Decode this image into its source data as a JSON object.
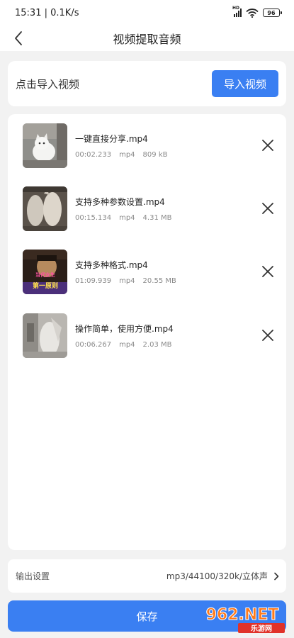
{
  "status_bar": {
    "time": "15:31 | 0.1K/s",
    "network_badge": "HD",
    "battery": "96"
  },
  "header": {
    "title": "视频提取音频"
  },
  "import": {
    "hint": "点击导入视频",
    "button_label": "导入视频"
  },
  "videos": [
    {
      "name": "一键直接分享.mp4",
      "duration": "00:02.233",
      "format": "mp4",
      "size": "809 kB"
    },
    {
      "name": "支持多种参数设置.mp4",
      "duration": "00:15.134",
      "format": "mp4",
      "size": "4.31 MB"
    },
    {
      "name": "支持多种格式.mp4",
      "duration": "01:09.939",
      "format": "mp4",
      "size": "20.55 MB"
    },
    {
      "name": "操作简单，使用方便.mp4",
      "duration": "00:06.267",
      "format": "mp4",
      "size": "2.03 MB"
    }
  ],
  "thumb_captions": {
    "line1": "当代女生",
    "line2": "第一原则"
  },
  "output": {
    "label": "输出设置",
    "value": "mp3/44100/320k/立体声"
  },
  "save_label": "保存",
  "watermark": {
    "brand": "962.NET",
    "sub": "乐游网"
  },
  "colors": {
    "accent": "#3a7ff2",
    "background": "#f2f2f2"
  },
  "icons": {
    "back": "chevron-left-icon",
    "remove": "close-icon",
    "output_arrow": "chevron-right-icon"
  }
}
